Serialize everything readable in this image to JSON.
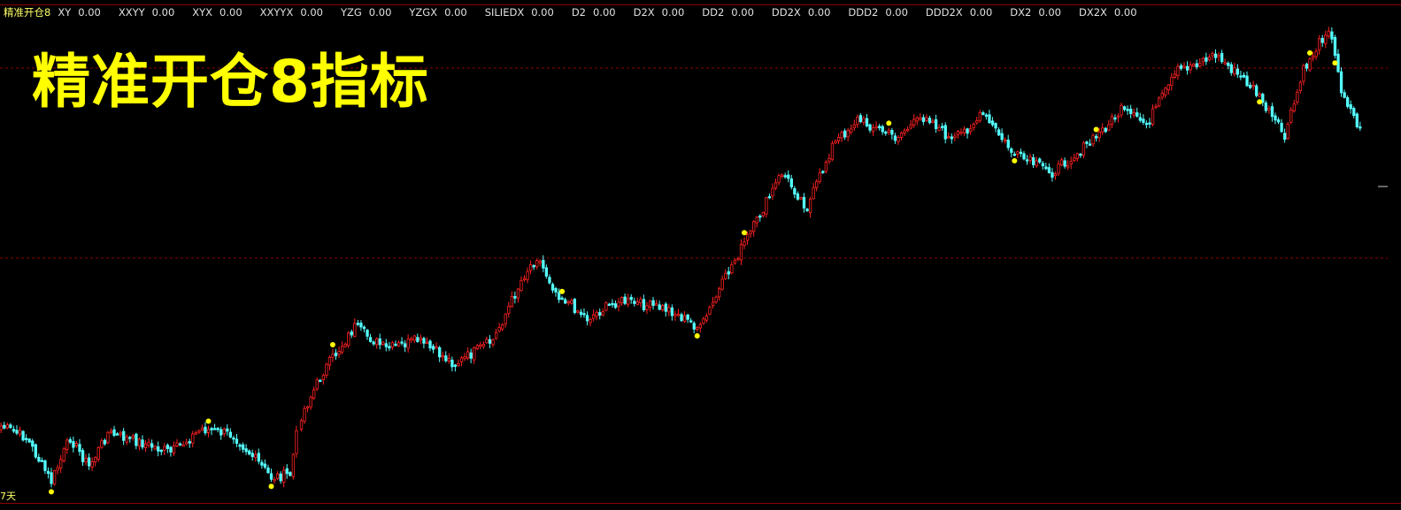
{
  "indicator": {
    "name": "精准开仓8",
    "items": [
      {
        "key": "XY",
        "value": "0.00"
      },
      {
        "key": "XXYY",
        "value": "0.00"
      },
      {
        "key": "XYX",
        "value": "0.00"
      },
      {
        "key": "XXYYX",
        "value": "0.00"
      },
      {
        "key": "YZG",
        "value": "0.00"
      },
      {
        "key": "YZGX",
        "value": "0.00"
      },
      {
        "key": "SILIEDX",
        "value": "0.00"
      },
      {
        "key": "D2",
        "value": "0.00"
      },
      {
        "key": "D2X",
        "value": "0.00"
      },
      {
        "key": "DD2",
        "value": "0.00"
      },
      {
        "key": "DD2X",
        "value": "0.00"
      },
      {
        "key": "DDD2",
        "value": "0.00"
      },
      {
        "key": "DDD2X",
        "value": "0.00"
      },
      {
        "key": "DX2",
        "value": "0.00"
      },
      {
        "key": "DX2X",
        "value": "0.00"
      }
    ]
  },
  "overlay_title": "精准开仓8指标",
  "period_label": "7天",
  "colors": {
    "up": "#ff2020",
    "down": "#54ffff",
    "signal": "#ffff00",
    "grid": "#8b0000",
    "title": "#ffff00"
  },
  "chart_data": {
    "type": "candlestick",
    "y_scale": "unlabeled",
    "horizontal_reference_lines": 2,
    "trend_anchors": [
      {
        "bar": 0,
        "close": 482
      },
      {
        "bar": 8,
        "close": 495
      },
      {
        "bar": 16,
        "close": 545
      },
      {
        "bar": 22,
        "close": 495
      },
      {
        "bar": 28,
        "close": 528
      },
      {
        "bar": 34,
        "close": 490
      },
      {
        "bar": 44,
        "close": 500
      },
      {
        "bar": 54,
        "close": 512
      },
      {
        "bar": 64,
        "close": 485
      },
      {
        "bar": 74,
        "close": 492
      },
      {
        "bar": 86,
        "close": 540
      },
      {
        "bar": 92,
        "close": 537
      },
      {
        "bar": 95,
        "close": 470
      },
      {
        "bar": 102,
        "close": 420
      },
      {
        "bar": 112,
        "close": 370
      },
      {
        "bar": 122,
        "close": 395
      },
      {
        "bar": 132,
        "close": 385
      },
      {
        "bar": 144,
        "close": 412
      },
      {
        "bar": 156,
        "close": 385
      },
      {
        "bar": 166,
        "close": 310
      },
      {
        "bar": 170,
        "close": 290
      },
      {
        "bar": 176,
        "close": 330
      },
      {
        "bar": 186,
        "close": 360
      },
      {
        "bar": 196,
        "close": 340
      },
      {
        "bar": 212,
        "close": 350
      },
      {
        "bar": 222,
        "close": 372
      },
      {
        "bar": 232,
        "close": 300
      },
      {
        "bar": 240,
        "close": 250
      },
      {
        "bar": 248,
        "close": 195
      },
      {
        "bar": 256,
        "close": 235
      },
      {
        "bar": 264,
        "close": 165
      },
      {
        "bar": 272,
        "close": 135
      },
      {
        "bar": 284,
        "close": 155
      },
      {
        "bar": 294,
        "close": 130
      },
      {
        "bar": 302,
        "close": 160
      },
      {
        "bar": 312,
        "close": 130
      },
      {
        "bar": 322,
        "close": 175
      },
      {
        "bar": 334,
        "close": 195
      },
      {
        "bar": 346,
        "close": 162
      },
      {
        "bar": 356,
        "close": 125
      },
      {
        "bar": 364,
        "close": 140
      },
      {
        "bar": 374,
        "close": 80
      },
      {
        "bar": 386,
        "close": 62
      },
      {
        "bar": 398,
        "close": 100
      },
      {
        "bar": 408,
        "close": 155
      },
      {
        "bar": 414,
        "close": 80
      },
      {
        "bar": 422,
        "close": 30
      },
      {
        "bar": 426,
        "close": 100
      },
      {
        "bar": 432,
        "close": 148
      }
    ],
    "signal_points": [
      {
        "bar": 16,
        "position": "low"
      },
      {
        "bar": 66,
        "position": "high"
      },
      {
        "bar": 86,
        "position": "low"
      },
      {
        "bar": 105,
        "position": "high"
      },
      {
        "bar": 178,
        "position": "high"
      },
      {
        "bar": 221,
        "position": "low"
      },
      {
        "bar": 236,
        "position": "high"
      },
      {
        "bar": 282,
        "position": "high"
      },
      {
        "bar": 322,
        "position": "low"
      },
      {
        "bar": 348,
        "position": "high"
      },
      {
        "bar": 400,
        "position": "low"
      },
      {
        "bar": 416,
        "position": "high"
      },
      {
        "bar": 424,
        "position": "low"
      }
    ]
  }
}
